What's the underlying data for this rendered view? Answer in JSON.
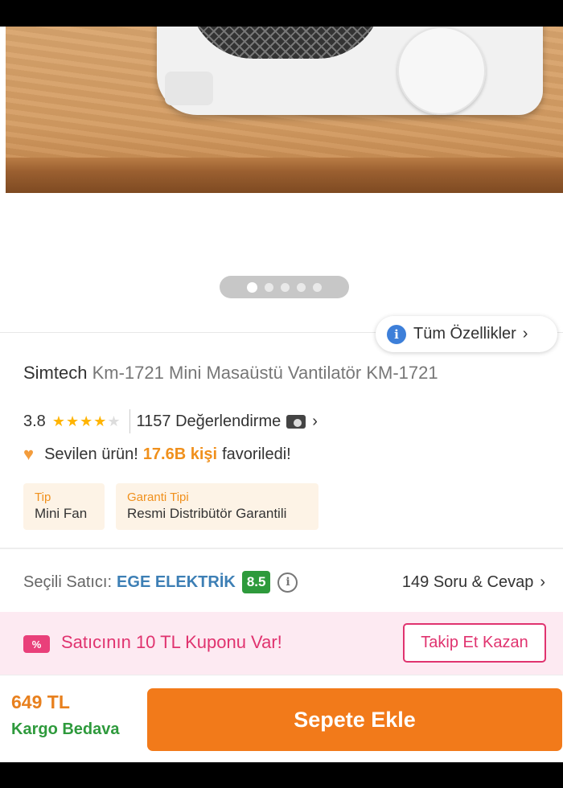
{
  "gallery": {
    "dots": 5,
    "active_index": 0
  },
  "features_button": {
    "label": "Tüm Özellikler",
    "chevron": "›"
  },
  "product": {
    "brand": "Simtech",
    "name": "Km-1721 Mini Masaüstü Vantilatör KM-1721"
  },
  "rating": {
    "score": "3.8",
    "stars_filled": 4,
    "reviews_label": "1157 Değerlendirme"
  },
  "favorite": {
    "prefix": "Sevilen ürün!",
    "highlight": "17.6B kişi",
    "suffix": "favoriledi!"
  },
  "attributes": [
    {
      "label": "Tip",
      "value": "Mini Fan"
    },
    {
      "label": "Garanti Tipi",
      "value": "Resmi Distribütör Garantili"
    }
  ],
  "seller": {
    "label": "Seçili Satıcı:",
    "name": "EGE ELEKTRİK",
    "score": "8.5",
    "qa_label": "149 Soru & Cevap"
  },
  "coupon": {
    "icon_text": "%",
    "text": "Satıcının 10 TL Kuponu Var!",
    "button_label": "Takip Et Kazan"
  },
  "buy": {
    "price": "649 TL",
    "shipping": "Kargo Bedava",
    "cart_button": "Sepete Ekle"
  },
  "colors": {
    "accent_orange": "#f27a1a",
    "seller_blue": "#3d7fb5",
    "score_green": "#2e9a3c",
    "coupon_pink": "#e0336f"
  },
  "icons": [
    "info-icon",
    "chevron-right-icon",
    "star-icon",
    "camera-icon",
    "heart-icon",
    "info-outline-icon",
    "coupon-icon"
  ]
}
